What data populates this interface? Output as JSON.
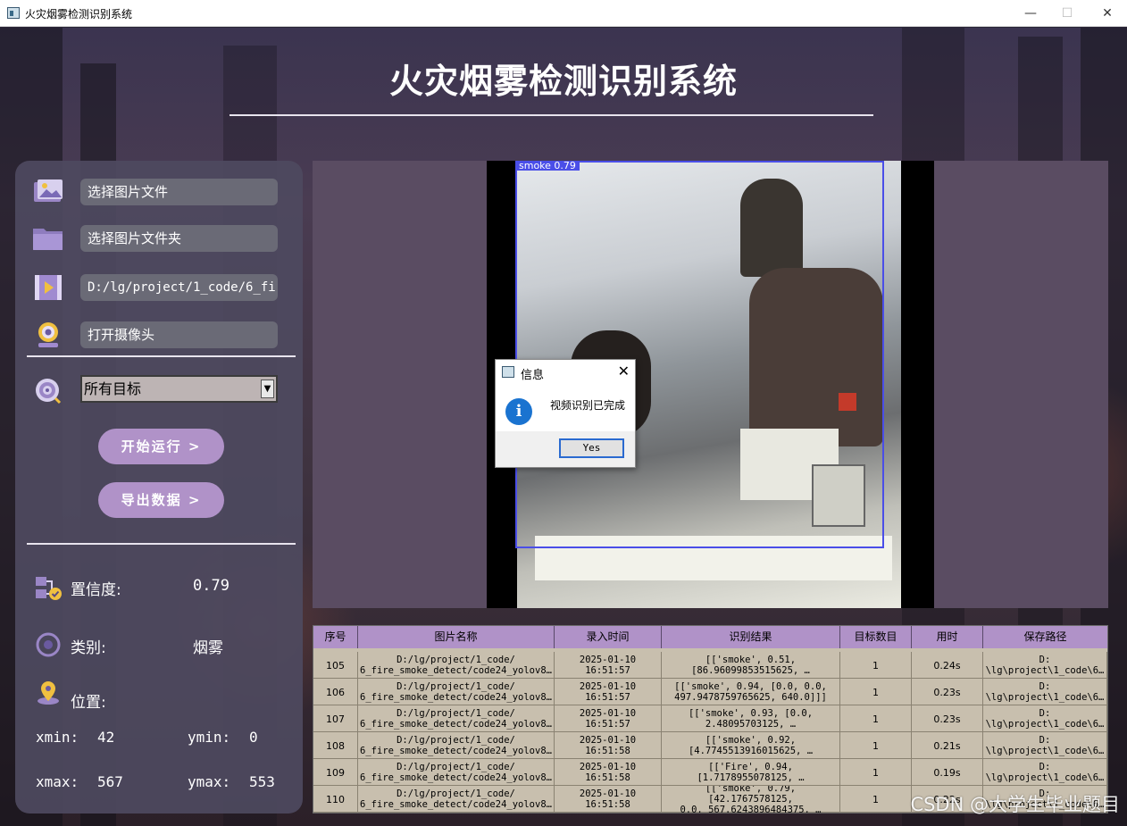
{
  "window": {
    "title": "火灾烟雾检测识别系统",
    "min_glyph": "—",
    "max_glyph": "☐",
    "close_glyph": "✕"
  },
  "header": {
    "title": "火灾烟雾检测识别系统"
  },
  "sidebar": {
    "image_file_btn": "选择图片文件",
    "image_folder_btn": "选择图片文件夹",
    "video_path": "D:/lg/project/1_code/6_fire",
    "camera_btn": "打开摄像头",
    "target_select": "所有目标",
    "start_btn": "开始运行 >",
    "export_btn": "导出数据 >",
    "confidence_label": "置信度:",
    "confidence_value": "0.79",
    "class_label": "类别:",
    "class_value": "烟雾",
    "position_label": "位置:",
    "xmin_label": "xmin:",
    "xmin_value": "42",
    "ymin_label": "ymin:",
    "ymin_value": "0",
    "xmax_label": "xmax:",
    "xmax_value": "567",
    "ymax_label": "ymax:",
    "ymax_value": "553"
  },
  "detection": {
    "label": "smoke 0.79",
    "box_color": "#4a4ee8"
  },
  "dialog": {
    "title": "信息",
    "message": "视频识别已完成",
    "yes_btn": "Yes",
    "icon": "info-icon"
  },
  "table": {
    "columns": [
      "序号",
      "图片名称",
      "录入时间",
      "识别结果",
      "目标数目",
      "用时",
      "保存路径"
    ],
    "rows": [
      {
        "id": "105",
        "name": "D:/lg/project/1_code/\n6_fire_smoke_detect/code24_yolov8…",
        "time": "2025-01-10\n16:51:57",
        "result": "[['smoke', 0.51,\n[86.96099853515625, …",
        "count": "1",
        "duration": "0.24s",
        "path": "D:\n\\lg\\project\\1_code\\6…"
      },
      {
        "id": "106",
        "name": "D:/lg/project/1_code/\n6_fire_smoke_detect/code24_yolov8…",
        "time": "2025-01-10\n16:51:57",
        "result": "[['smoke', 0.94, [0.0, 0.0,\n497.9478759765625, 640.0]]]",
        "count": "1",
        "duration": "0.23s",
        "path": "D:\n\\lg\\project\\1_code\\6…"
      },
      {
        "id": "107",
        "name": "D:/lg/project/1_code/\n6_fire_smoke_detect/code24_yolov8…",
        "time": "2025-01-10\n16:51:57",
        "result": "[['smoke', 0.93, [0.0,\n2.48095703125, …",
        "count": "1",
        "duration": "0.23s",
        "path": "D:\n\\lg\\project\\1_code\\6…"
      },
      {
        "id": "108",
        "name": "D:/lg/project/1_code/\n6_fire_smoke_detect/code24_yolov8…",
        "time": "2025-01-10\n16:51:58",
        "result": "[['smoke', 0.92,\n[4.7745513916015625, …",
        "count": "1",
        "duration": "0.21s",
        "path": "D:\n\\lg\\project\\1_code\\6…"
      },
      {
        "id": "109",
        "name": "D:/lg/project/1_code/\n6_fire_smoke_detect/code24_yolov8…",
        "time": "2025-01-10\n16:51:58",
        "result": "[['Fire', 0.94,\n[1.7178955078125, …",
        "count": "1",
        "duration": "0.19s",
        "path": "D:\n\\lg\\project\\1_code\\6…"
      },
      {
        "id": "110",
        "name": "D:/lg/project/1_code/\n6_fire_smoke_detect/code24_yolov8…",
        "time": "2025-01-10\n16:51:58",
        "result": "[['smoke', 0.79, [42.1767578125,\n0.0, 567.6243896484375, …",
        "count": "1",
        "duration": "0.22s",
        "path": "D:\n\\lg\\project\\1_code\\6…"
      }
    ]
  },
  "watermark": "CSDN @大学生毕业题目"
}
